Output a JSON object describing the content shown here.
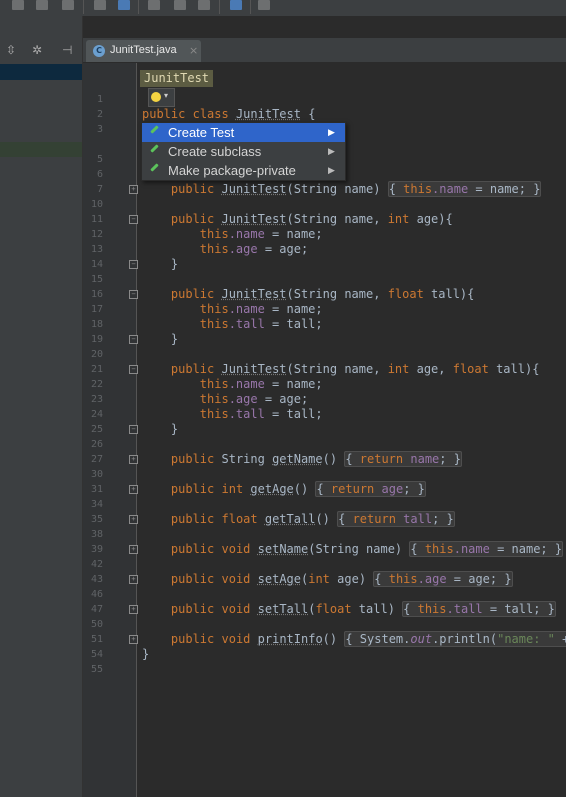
{
  "tab": {
    "label": "JunitTest.java",
    "close": "×",
    "icon": "C"
  },
  "breadcrumb": "JunitTest",
  "popup": {
    "items": [
      {
        "label": "Create Test",
        "arrow": "▶"
      },
      {
        "label": "Create subclass",
        "arrow": "▶"
      },
      {
        "label": "Make package-private",
        "arrow": "▶"
      }
    ]
  },
  "line_numbers": [
    "1",
    "2",
    "3",
    "5",
    "6",
    "7",
    "10",
    "11",
    "12",
    "13",
    "14",
    "15",
    "16",
    "17",
    "18",
    "19",
    "20",
    "21",
    "22",
    "23",
    "24",
    "25",
    "26",
    "27",
    "30",
    "31",
    "34",
    "35",
    "38",
    "39",
    "42",
    "43",
    "46",
    "47",
    "50",
    "51",
    "54",
    "55"
  ],
  "code": {
    "l2": {
      "kw1": "public",
      "kw2": "class",
      "name": "JunitTest",
      "rest": " {"
    },
    "l7": {
      "kw": "public",
      "ctor": "JunitTest",
      "args": "(String name) ",
      "body_kw": "this",
      "body": ".name",
      "body2": " = name; ",
      "close": "}"
    },
    "l11": {
      "kw": "public",
      "ctor": "JunitTest",
      "a1": "(String name, ",
      "t": "int",
      "a2": " age){"
    },
    "l12": {
      "kw": "this",
      "f": ".name",
      "r": " = name;"
    },
    "l13": {
      "kw": "this",
      "f": ".age",
      "r": " = age;"
    },
    "l14": "}",
    "l16": {
      "kw": "public",
      "ctor": "JunitTest",
      "a1": "(String name, ",
      "t": "float",
      "a2": " tall){"
    },
    "l17": {
      "kw": "this",
      "f": ".name",
      "r": " = name;"
    },
    "l18": {
      "kw": "this",
      "f": ".tall",
      "r": " = tall;"
    },
    "l19": "}",
    "l21": {
      "kw": "public",
      "ctor": "JunitTest",
      "a1": "(String name, ",
      "t1": "int",
      "a2": " age, ",
      "t2": "float",
      "a3": " tall){"
    },
    "l22": {
      "kw": "this",
      "f": ".name",
      "r": " = name;"
    },
    "l23": {
      "kw": "this",
      "f": ".age",
      "r": " = age;"
    },
    "l24": {
      "kw": "this",
      "f": ".tall",
      "r": " = tall;"
    },
    "l25": "}",
    "l27": {
      "kw": "public",
      "type": " String ",
      "m": "getName",
      "p": "() ",
      "b1": "{ ",
      "ret": "return",
      "f": " name",
      "b2": "; }"
    },
    "l31": {
      "kw": "public",
      "type": "int",
      "m": "getAge",
      "p": "() ",
      "b1": "{ ",
      "ret": "return",
      "f": " age",
      "b2": "; }"
    },
    "l35": {
      "kw": "public",
      "type": "float",
      "m": "getTall",
      "p": "() ",
      "b1": "{ ",
      "ret": "return",
      "f": " tall",
      "b2": "; }"
    },
    "l39": {
      "kw": "public",
      "type": "void",
      "m": "setName",
      "p": "(String name) ",
      "b1": "{ ",
      "th": "this",
      "f": ".name",
      "b2": " = name; }"
    },
    "l43": {
      "kw": "public",
      "type": "void",
      "m": "setAge",
      "p1": "(",
      "t": "int",
      "p2": " age) ",
      "b1": "{ ",
      "th": "this",
      "f": ".age",
      "b2": " = age; }"
    },
    "l47": {
      "kw": "public",
      "type": "void",
      "m": "setTall",
      "p1": "(",
      "t": "float",
      "p2": " tall) ",
      "b1": "{ ",
      "th": "this",
      "f": ".tall",
      "b2": " = tall; }"
    },
    "l51": {
      "kw": "public",
      "type": "void",
      "m": "printInfo",
      "p": "() ",
      "b1": "{ System.",
      "out": "out",
      "b2": ".println(",
      "str": "\"name: \"",
      "b3": " + n"
    },
    "l54": "}"
  }
}
